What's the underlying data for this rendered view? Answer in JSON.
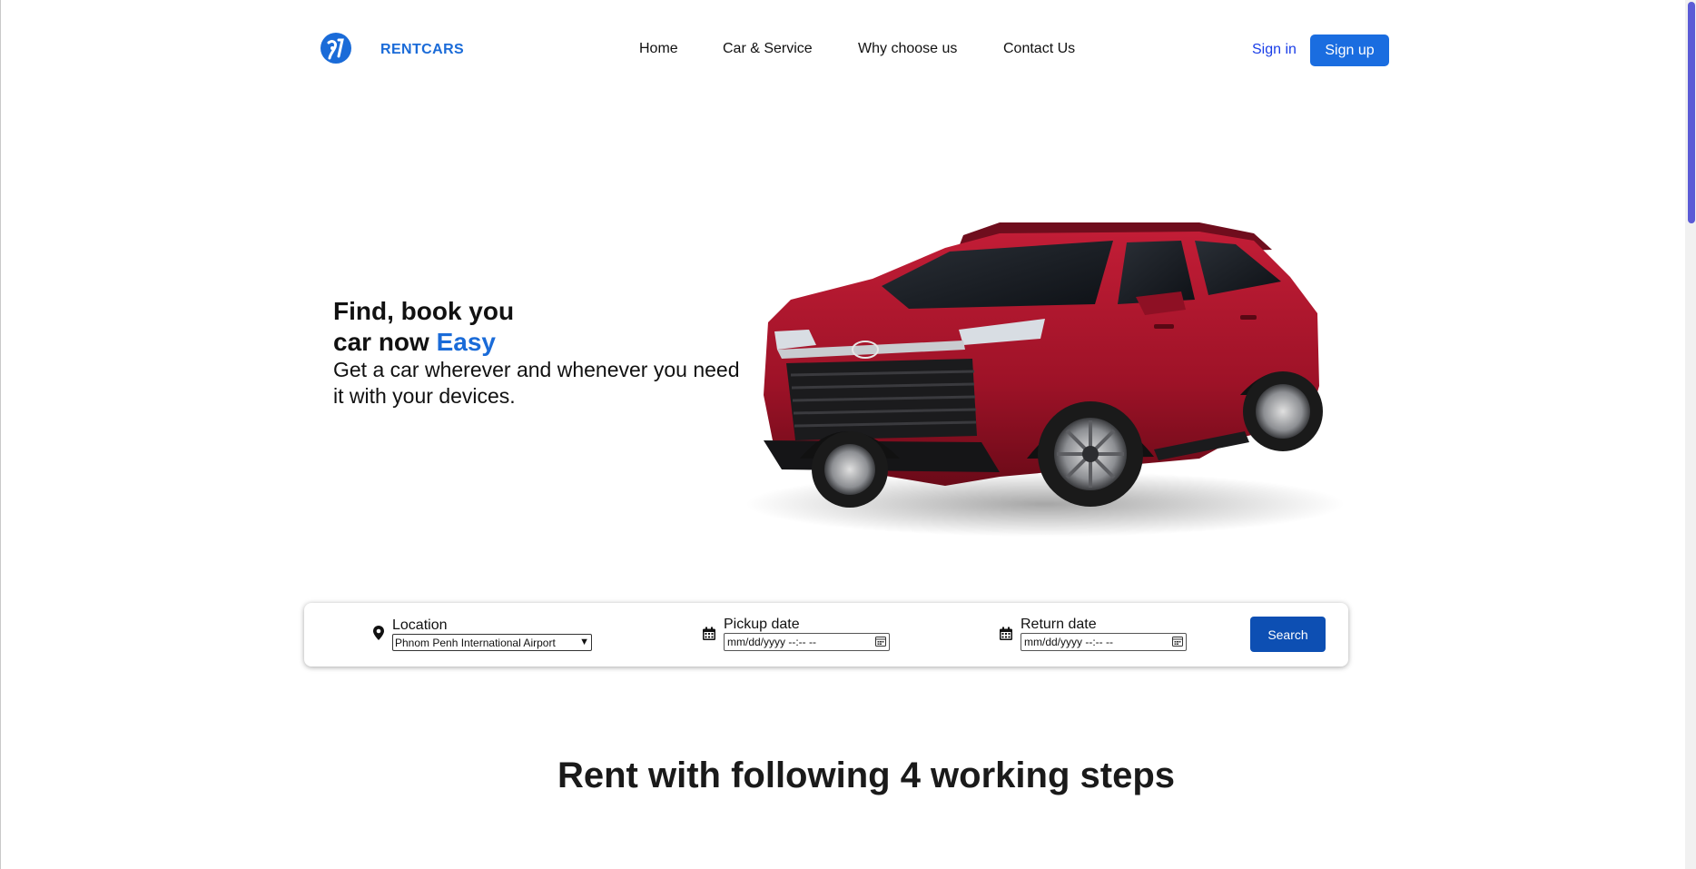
{
  "header": {
    "brand": "RENTCARS",
    "nav": [
      "Home",
      "Car & Service",
      "Why choose us",
      "Contact Us"
    ],
    "sign_in": "Sign in",
    "sign_up": "Sign up"
  },
  "hero": {
    "title_line1": "Find, book you",
    "title_line2": "car now ",
    "title_accent": "Easy",
    "subtitle": "Get a car wherever and whenever you need it with your devices."
  },
  "search": {
    "location_label": "Location",
    "location_value": "Phnom Penh International Airport",
    "pickup_label": "Pickup date",
    "pickup_placeholder": "mm/dd/yyyy  --:-- --",
    "return_label": "Return date",
    "return_placeholder": "mm/dd/yyyy  --:-- --",
    "button": "Search"
  },
  "steps": {
    "title": "Rent with following 4 working steps"
  },
  "colors": {
    "accent": "#1a6bd8",
    "primary_button": "#1a6de0",
    "search_button": "#0d4fb3",
    "car_body": "#a0142a"
  },
  "icons": [
    "logo-icon",
    "map-pin-icon",
    "calendar-icon",
    "calendar-icon"
  ]
}
